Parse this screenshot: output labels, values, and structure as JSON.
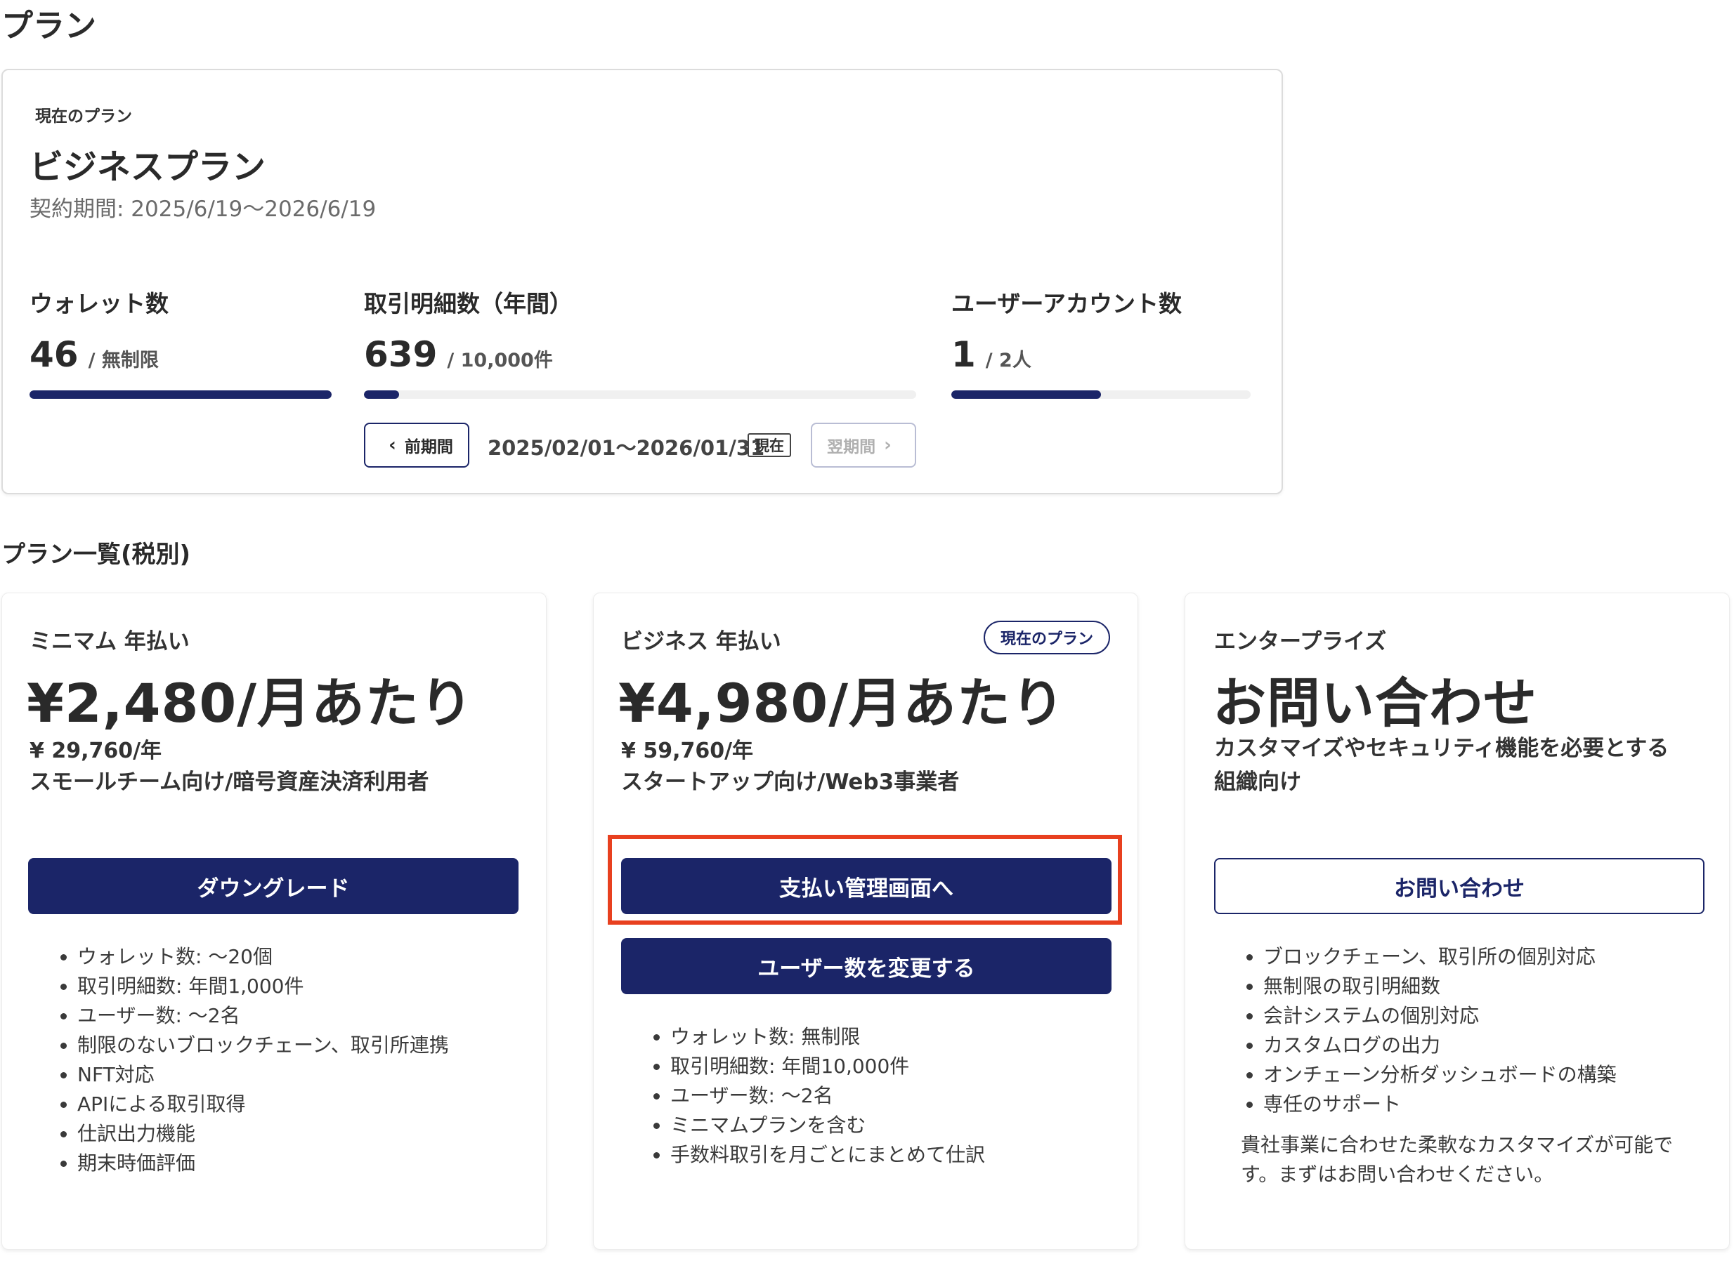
{
  "page": {
    "title": "プラン"
  },
  "current_plan": {
    "label": "現在のプラン",
    "name": "ビジネスプラン",
    "period": "契約期間: 2025/6/19〜2026/6/19",
    "metrics": [
      {
        "label": "ウォレット数",
        "value": "46",
        "limit": "/ 無制限",
        "fill": 1.0
      },
      {
        "label": "取引明細数（年間）",
        "value": "639",
        "limit": "/ 10,000件",
        "fill": 0.064
      },
      {
        "label": "ユーザーアカウント数",
        "value": "1",
        "limit": "/ 2人",
        "fill": 0.5
      }
    ],
    "nav": {
      "prev_label": "前期間",
      "range": "2025/02/01〜2026/01/31",
      "current_badge": "現在",
      "next_label": "翌期間"
    }
  },
  "plans_section": {
    "title": "プラン一覧(税別)",
    "plans": [
      {
        "name": "ミニマム 年払い",
        "price": "¥2,480/月あたり",
        "yearly": "¥ 29,760/年",
        "description": "スモールチーム向け/暗号資産決済利用者",
        "buttons": [
          "ダウングレード"
        ],
        "features": [
          "ウォレット数: 〜20個",
          "取引明細数: 年間1,000件",
          "ユーザー数: 〜2名",
          "制限のないブロックチェーン、取引所連携",
          "NFT対応",
          "APIによる取引取得",
          "仕訳出力機能",
          "期末時価評価"
        ]
      },
      {
        "name": "ビジネス 年払い",
        "badge": "現在のプラン",
        "price": "¥4,980/月あたり",
        "yearly": "¥ 59,760/年",
        "description": "スタートアップ向け/Web3事業者",
        "buttons": [
          "支払い管理画面へ",
          "ユーザー数を変更する"
        ],
        "features": [
          "ウォレット数: 無制限",
          "取引明細数: 年間10,000件",
          "ユーザー数: 〜2名",
          "ミニマムプランを含む",
          "手数料取引を月ごとにまとめて仕訳"
        ]
      },
      {
        "name": "エンタープライズ",
        "price": "お問い合わせ",
        "description_line1": "カスタマイズやセキュリティ機能を必要とする",
        "description_line2": "組織向け",
        "buttons": [
          "お問い合わせ"
        ],
        "features": [
          "ブロックチェーン、取引所の個別対応",
          "無制限の取引明細数",
          "会計システムの個別対応",
          "カスタムログの出力",
          "オンチェーン分析ダッシュボードの構築",
          "専任のサポート"
        ],
        "note": "貴社事業に合わせた柔軟なカスタマイズが可能です。まずはお問い合わせください。"
      }
    ]
  },
  "colors": {
    "primary": "#1b2568",
    "highlight": "#e8401f",
    "track": "#f0f0f0"
  }
}
